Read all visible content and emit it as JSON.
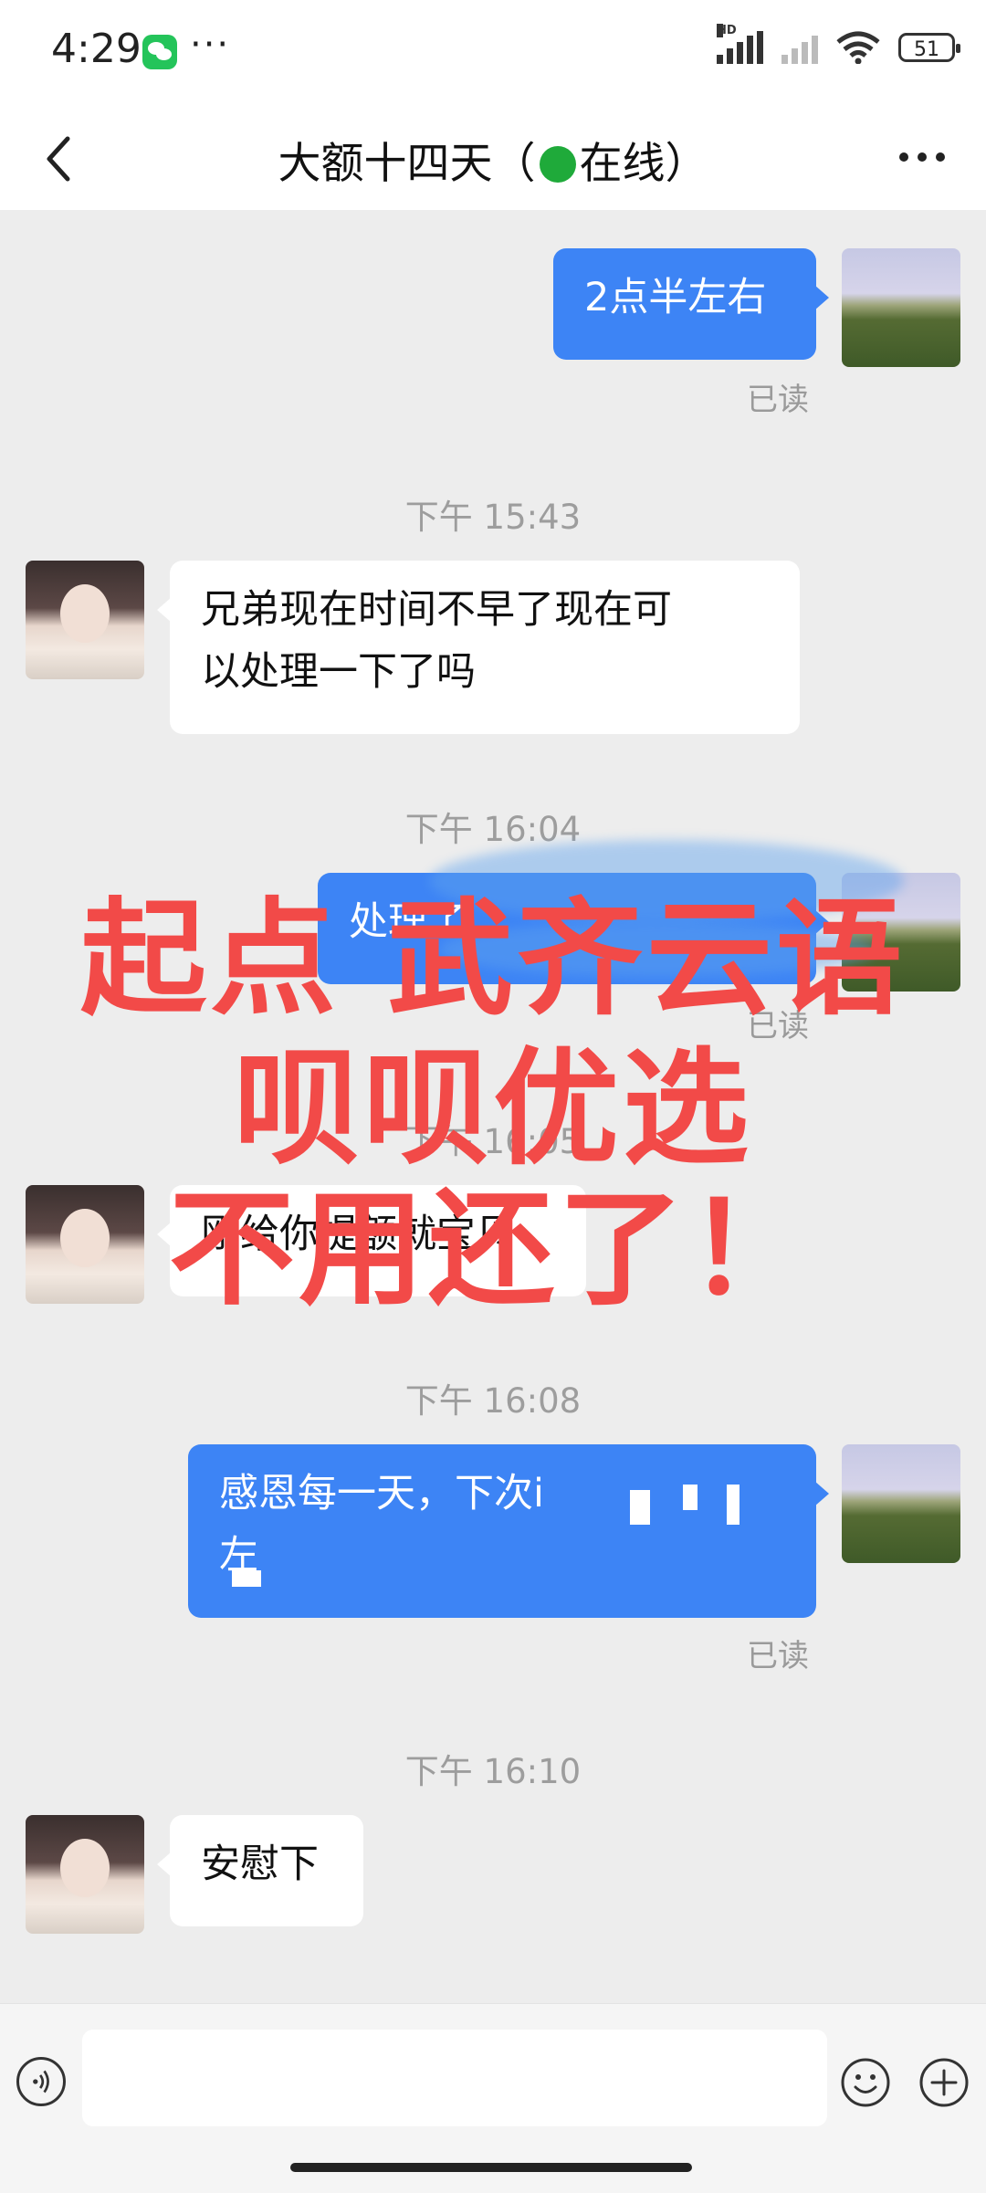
{
  "status_bar": {
    "time": "4:29",
    "dots": "···",
    "battery": "51",
    "signal_label": "HD"
  },
  "header": {
    "title_name": "大额十四天（",
    "title_status": "在线）"
  },
  "messages": [
    {
      "type": "out",
      "text": "2点半左右",
      "read": "已读"
    },
    {
      "type": "timestamp",
      "text": "下午 15:43"
    },
    {
      "type": "in",
      "text_line1": "兄弟现在时间不早了现在可",
      "text_line2": "以处理一下了吗"
    },
    {
      "type": "timestamp",
      "text": "下午 16:04"
    },
    {
      "type": "out",
      "text": "处理了",
      "read": "已读"
    },
    {
      "type": "timestamp",
      "text": "下午 16:05"
    },
    {
      "type": "in",
      "text": "刚给你提额就宝贝"
    },
    {
      "type": "timestamp",
      "text": "下午 16:08"
    },
    {
      "type": "out",
      "text_line1": "感恩每一天，下次i",
      "text_line2": "左",
      "read": "已读"
    },
    {
      "type": "timestamp",
      "text": "下午 16:10"
    },
    {
      "type": "in",
      "text": "安慰下"
    }
  ],
  "watermark": {
    "line1": "起点 武齐云语",
    "line2": "呗呗优选",
    "line3": "不用还了！",
    "color": "#f24a48"
  },
  "colors": {
    "out_bubble": "#3d84f5",
    "in_bubble": "#ffffff",
    "background": "#ededed",
    "online": "#1faa3a"
  },
  "icons": {
    "back": "chevron-left-icon",
    "more": "more-icon",
    "voice": "voice-icon",
    "emoji": "emoji-icon",
    "plus": "plus-icon"
  }
}
